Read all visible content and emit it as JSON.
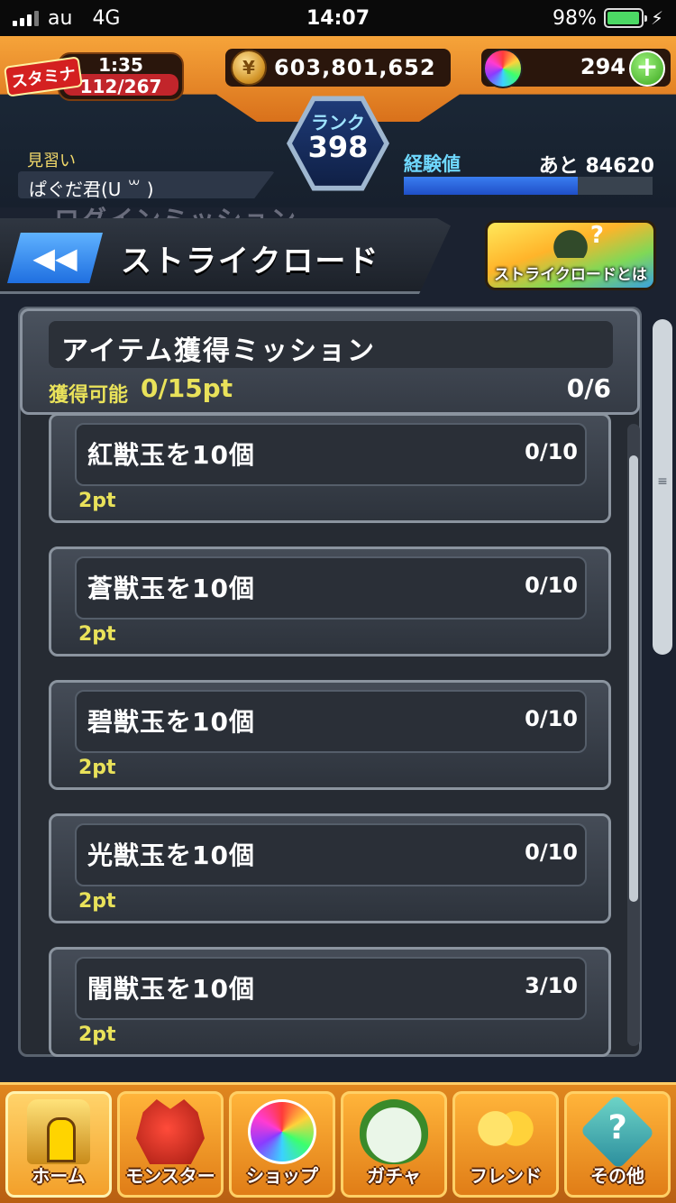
{
  "status_bar": {
    "carrier": "au",
    "network": "4G",
    "time": "14:07",
    "battery_percent": "98%",
    "battery_level": 0.98
  },
  "hud": {
    "stamina_label": "スタミナ",
    "stamina_timer": "1:35",
    "stamina_value": "112/267",
    "coins": "603,801,652",
    "orbs": "294",
    "plus_symbol": "+",
    "rank_label": "ランク",
    "rank_value": "398",
    "title": "見習い",
    "player_name": "ぱぐだ君(U ꒳ )",
    "exp_label": "経験値",
    "exp_remaining": "あと 84620",
    "exp_fraction": 0.7
  },
  "background_text": "ログインミッション",
  "header": {
    "back_label": "◀◀",
    "title": "ストライクロード",
    "info_label": "ストライクロードとは",
    "info_symbol": "?"
  },
  "panel": {
    "title": "アイテム獲得ミッション",
    "available_label": "獲得可能",
    "available_value": "0/15pt",
    "progress": "0/6"
  },
  "missions": [
    {
      "name": "紅獣玉を10個",
      "progress": "0/10",
      "points": "2pt"
    },
    {
      "name": "蒼獣玉を10個",
      "progress": "0/10",
      "points": "2pt"
    },
    {
      "name": "碧獣玉を10個",
      "progress": "0/10",
      "points": "2pt"
    },
    {
      "name": "光獣玉を10個",
      "progress": "0/10",
      "points": "2pt"
    },
    {
      "name": "闇獣玉を10個",
      "progress": "3/10",
      "points": "2pt"
    }
  ],
  "nav": [
    {
      "label": "ホーム",
      "icon": "home-icon",
      "active": true
    },
    {
      "label": "モンスター",
      "icon": "monster-icon",
      "active": false
    },
    {
      "label": "ショップ",
      "icon": "shop-icon",
      "active": false
    },
    {
      "label": "ガチャ",
      "icon": "gacha-icon",
      "active": false
    },
    {
      "label": "フレンド",
      "icon": "friend-icon",
      "active": false
    },
    {
      "label": "その他",
      "icon": "other-icon",
      "active": false
    }
  ],
  "colors": {
    "accent_yellow": "#e9e25a",
    "exp_blue": "#2f66e0",
    "nav_orange": "#e0871f"
  }
}
